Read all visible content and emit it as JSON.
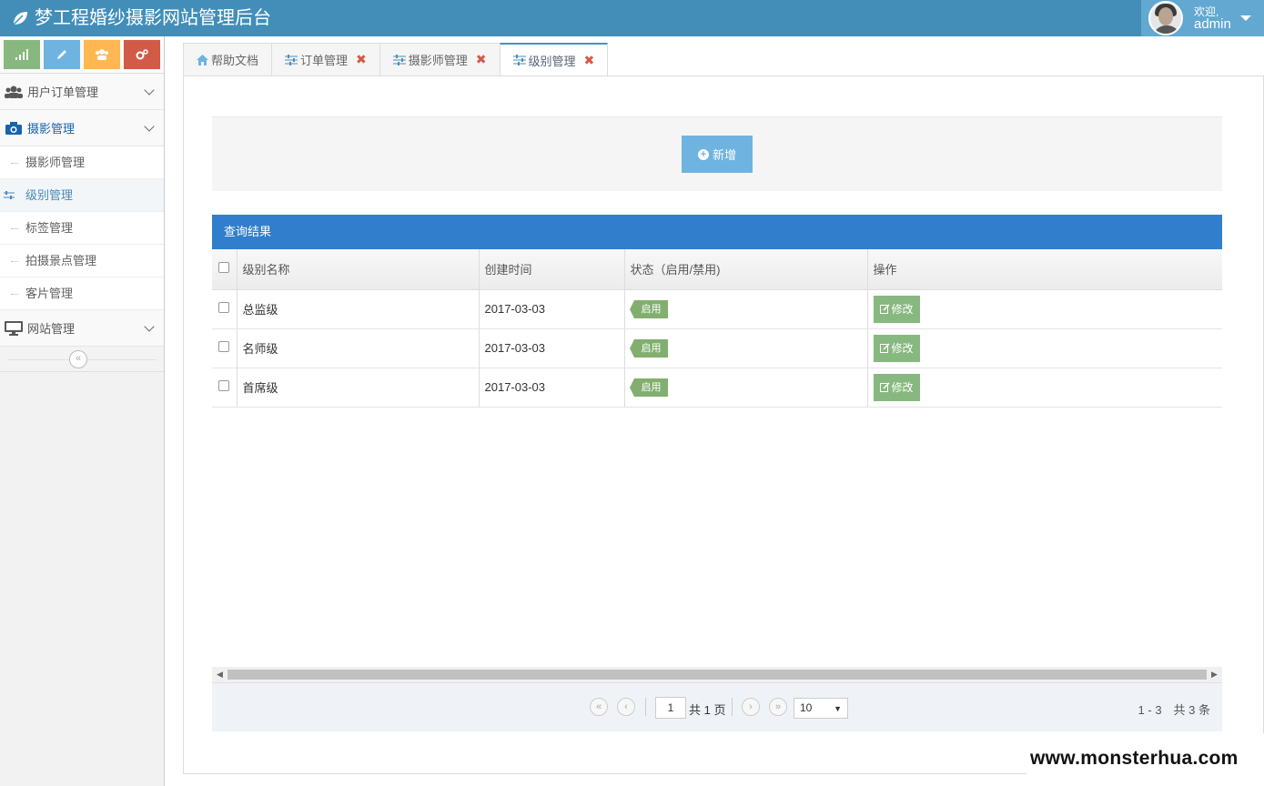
{
  "app": {
    "title": "梦工程婚纱摄影网站管理后台",
    "brand_icon": "leaf-icon",
    "theme_color": "#438eb9"
  },
  "user": {
    "welcome": "欢迎,",
    "name": "admin"
  },
  "sidebar": {
    "shortcuts": [
      {
        "icon": "signal-icon",
        "color": "#87b87f"
      },
      {
        "icon": "pencil-icon",
        "color": "#6fb3e0"
      },
      {
        "icon": "users-icon",
        "color": "#ffb752"
      },
      {
        "icon": "cogs-icon",
        "color": "#d15b47"
      }
    ],
    "menus": [
      {
        "label": "用户订单管理",
        "icon": "users-icon"
      },
      {
        "label": "摄影管理",
        "icon": "camera-icon",
        "items": [
          "摄影师管理",
          "级别管理",
          "标签管理",
          "拍摄景点管理",
          "客片管理"
        ]
      },
      {
        "label": "网站管理",
        "icon": "desktop-icon"
      }
    ],
    "active_item": "级别管理"
  },
  "tabs": [
    {
      "label": "帮助文档",
      "icon": "home-icon",
      "closable": false
    },
    {
      "label": "订单管理",
      "icon": "sliders-icon",
      "closable": true
    },
    {
      "label": "摄影师管理",
      "icon": "sliders-icon",
      "closable": true
    },
    {
      "label": "级别管理",
      "icon": "sliders-icon",
      "closable": true,
      "active": true
    }
  ],
  "toolbar": {
    "add_label": "新增"
  },
  "grid": {
    "title": "查询结果",
    "columns": [
      "级别名称",
      "创建时间",
      "状态（启用/禁用)",
      "操作"
    ],
    "rows": [
      {
        "name": "总监级",
        "created": "2017-03-03",
        "status": "启用",
        "action": "修改"
      },
      {
        "name": "名师级",
        "created": "2017-03-03",
        "status": "启用",
        "action": "修改"
      },
      {
        "name": "首席级",
        "created": "2017-03-03",
        "status": "启用",
        "action": "修改"
      }
    ]
  },
  "pager": {
    "page": "1",
    "total_pages": "共 1 页",
    "page_size": "10",
    "info": "1 - 3　共 3 条"
  },
  "watermark": "www.monsterhua.com"
}
